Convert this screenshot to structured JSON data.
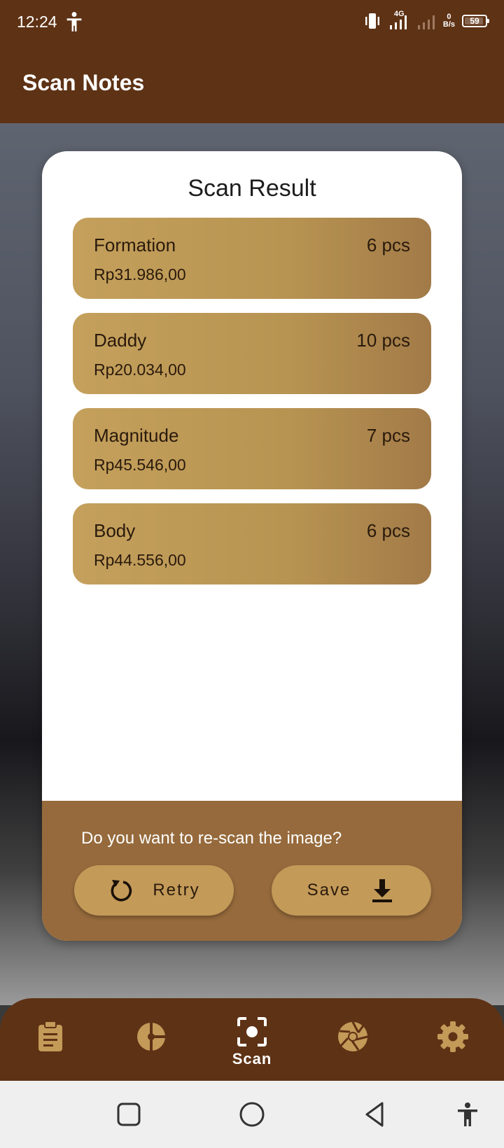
{
  "status_bar": {
    "time": "12:24",
    "network": "4G",
    "net_speed_value": "0",
    "net_speed_unit": "B/s",
    "battery": "59"
  },
  "app_bar": {
    "title": "Scan Notes"
  },
  "card": {
    "title": "Scan Result",
    "items": [
      {
        "name": "Formation",
        "qty": "6 pcs",
        "price": "Rp31.986,00"
      },
      {
        "name": "Daddy",
        "qty": "10 pcs",
        "price": "Rp20.034,00"
      },
      {
        "name": "Magnitude",
        "qty": "7 pcs",
        "price": "Rp45.546,00"
      },
      {
        "name": "Body",
        "qty": "6 pcs",
        "price": "Rp44.556,00"
      }
    ],
    "footer": {
      "question": "Do you want to re-scan the image?",
      "retry_label": "Retry",
      "save_label": "Save"
    }
  },
  "bottom_nav": {
    "items": [
      {
        "icon": "clipboard-icon"
      },
      {
        "icon": "chart-icon"
      },
      {
        "icon": "scan-icon",
        "label": "Scan",
        "active": true
      },
      {
        "icon": "aperture-icon"
      },
      {
        "icon": "gear-icon"
      }
    ]
  },
  "colors": {
    "primary_dark": "#5e3215",
    "accent_gold": "#c39a58",
    "footer_brown": "#966a3c"
  }
}
